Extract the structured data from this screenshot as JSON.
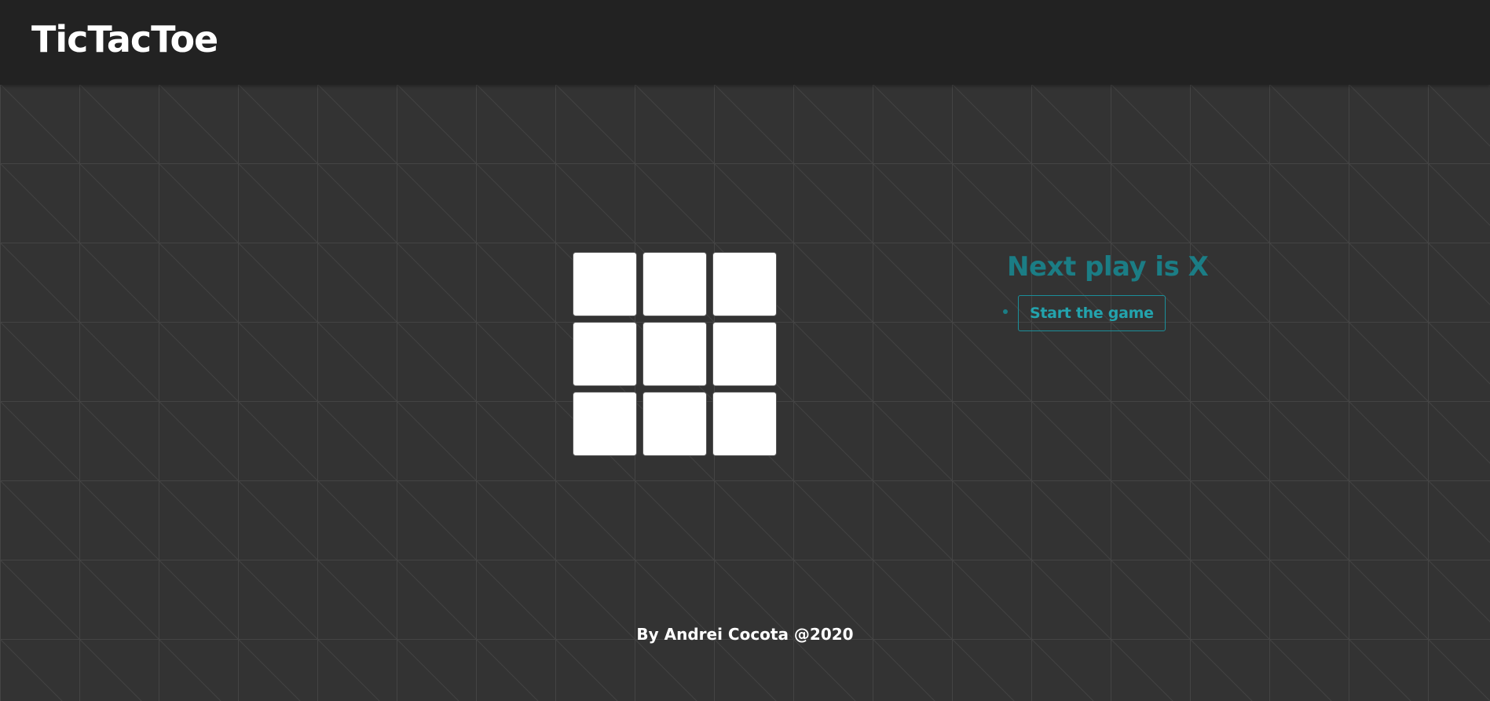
{
  "header": {
    "title": "TicTacToe"
  },
  "board": {
    "cells": [
      "",
      "",
      "",
      "",
      "",
      "",
      "",
      "",
      ""
    ]
  },
  "game": {
    "status": "Next play is X",
    "moves": [
      {
        "label": "Start the game"
      }
    ]
  },
  "footer": {
    "credit": "By Andrei Cocota @2020"
  },
  "colors": {
    "background": "#333333",
    "header": "#222222",
    "accent": "#1b7d85",
    "cell": "#ffffff"
  }
}
